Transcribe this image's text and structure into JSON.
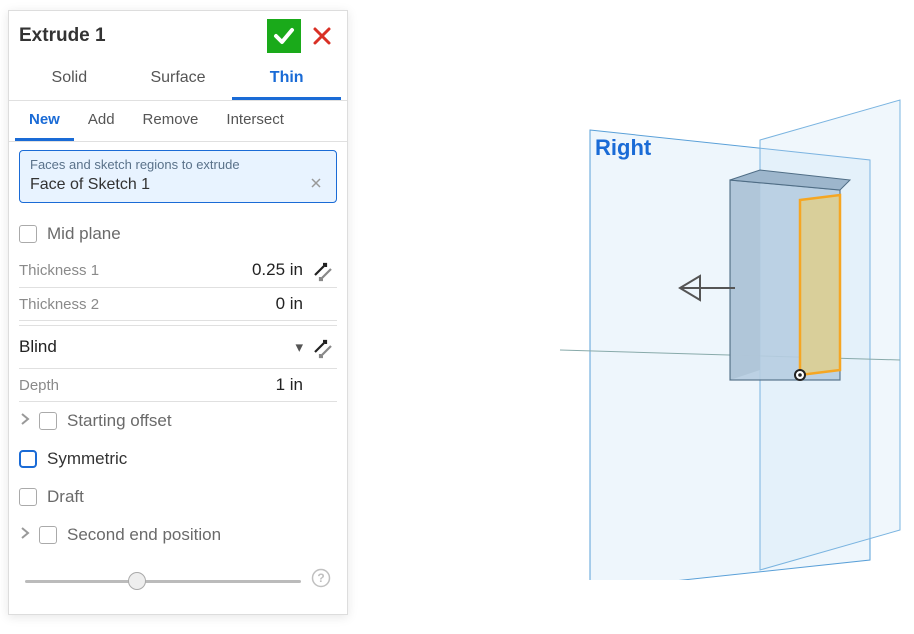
{
  "panel": {
    "title": "Extrude 1",
    "tabs": [
      "Solid",
      "Surface",
      "Thin"
    ],
    "active_tab": "Thin",
    "subtabs": [
      "New",
      "Add",
      "Remove",
      "Intersect"
    ],
    "active_subtab": "New",
    "selection": {
      "label": "Faces and sketch regions to extrude",
      "value": "Face of Sketch 1"
    },
    "mid_plane": {
      "label": "Mid plane",
      "checked": false
    },
    "thickness1": {
      "label": "Thickness 1",
      "value": "0.25 in"
    },
    "thickness2": {
      "label": "Thickness 2",
      "value": "0 in"
    },
    "end_type": {
      "value": "Blind"
    },
    "depth": {
      "label": "Depth",
      "value": "1 in"
    },
    "starting_offset": {
      "label": "Starting offset",
      "checked": false
    },
    "symmetric": {
      "label": "Symmetric",
      "checked": false
    },
    "draft": {
      "label": "Draft",
      "checked": false
    },
    "second_end": {
      "label": "Second end position",
      "checked": false
    }
  },
  "viewport": {
    "plane_label": "Right"
  }
}
